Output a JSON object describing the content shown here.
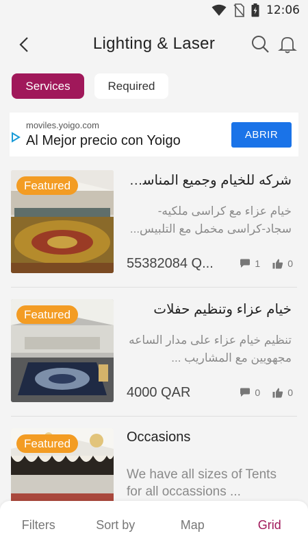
{
  "status_bar": {
    "time": "12:06",
    "icons": [
      "wifi-icon",
      "no-sim-icon",
      "battery-icon"
    ]
  },
  "header": {
    "title": "Lighting & Laser",
    "icons": [
      "back-arrow-icon",
      "search-icon",
      "bell-icon"
    ]
  },
  "tabs": [
    {
      "label": "Services",
      "active": true
    },
    {
      "label": "Required",
      "active": false
    }
  ],
  "ad": {
    "domain": "moviles.yoigo.com",
    "headline": "Al Mejor precio con Yoigo",
    "button": "ABRIR"
  },
  "listings": [
    {
      "badge": "Featured",
      "title": "شركه للخيام وجميع المناسب...",
      "description": "خيام عزاء مع كراسى ملكيه- سجاد-كراسى مخمل مع التلبيس...",
      "price": "55382084 Q...",
      "comments": "1",
      "likes": "0"
    },
    {
      "badge": "Featured",
      "title": "خيام عزاء وتنظيم حفلات",
      "description": "تنظيم خيام عزاء على مدار الساعه مجهويين  مع المشاريب ...",
      "price": "4000 QAR",
      "comments": "0",
      "likes": "0"
    },
    {
      "badge": "Featured",
      "title": "Occasions",
      "description": "We have all sizes of Tents for all occassions ...",
      "price": "",
      "comments": "",
      "likes": ""
    }
  ],
  "bottom_nav": {
    "filters": "Filters",
    "sort_by": "Sort by",
    "map": "Map",
    "grid": "Grid"
  },
  "colors": {
    "accent": "#a0185a",
    "badge": "#f39c23",
    "ad_button": "#1a73e8"
  }
}
